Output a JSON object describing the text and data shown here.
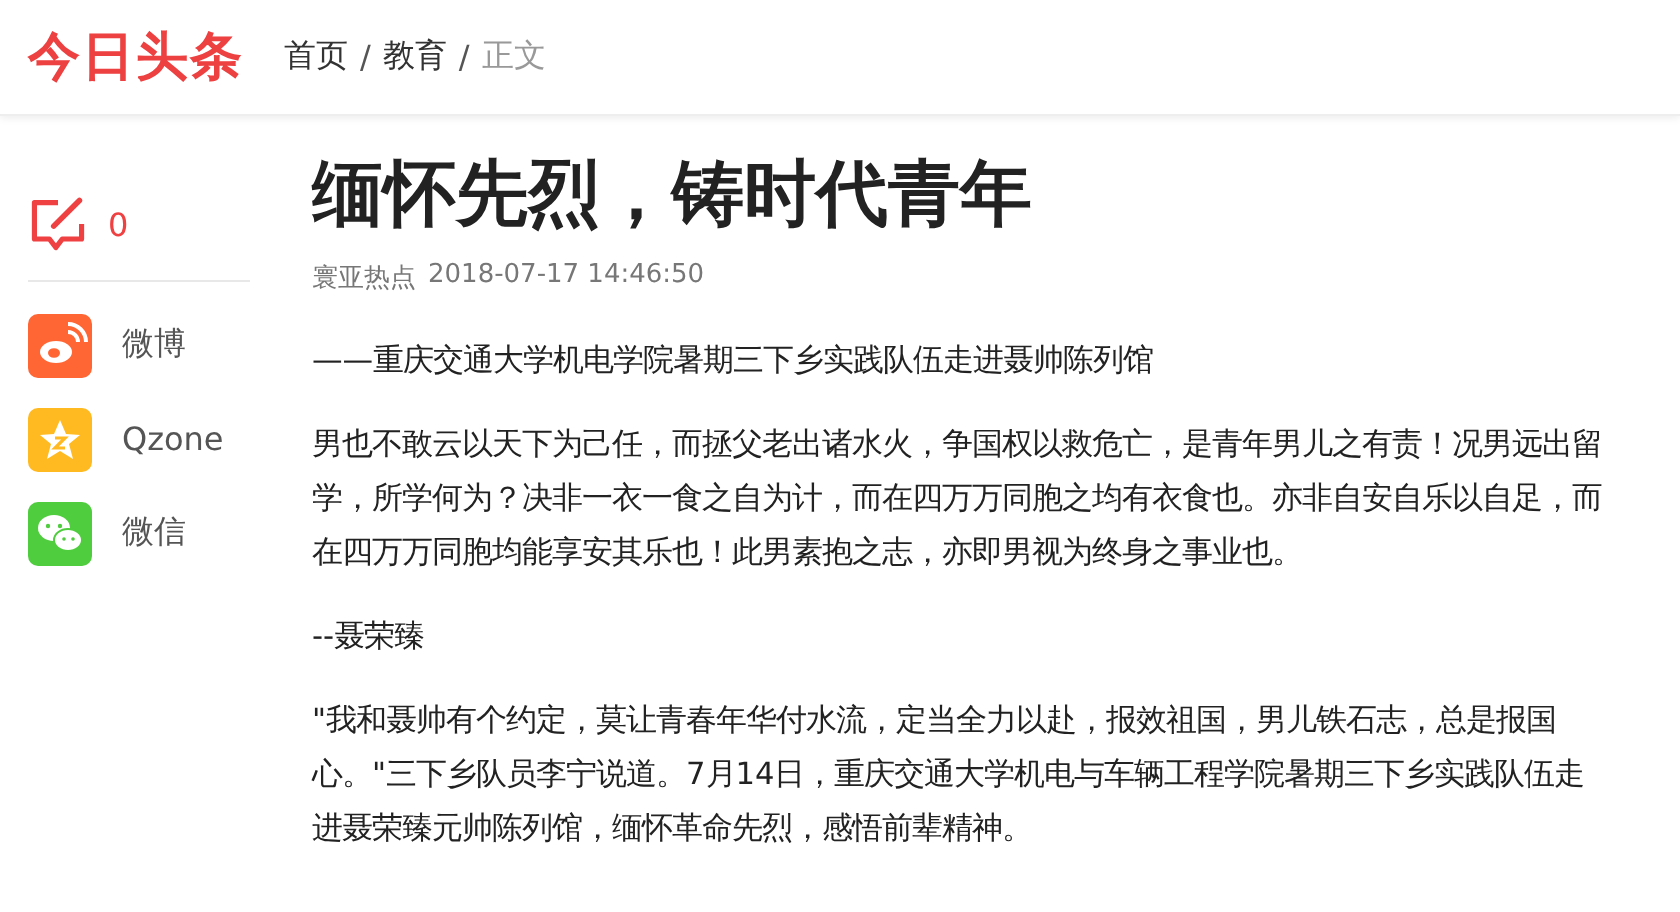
{
  "header": {
    "logo": "今日头条",
    "separator": "/",
    "breadcrumb": [
      {
        "label": "首页",
        "current": false
      },
      {
        "label": "教育",
        "current": false
      },
      {
        "label": "正文",
        "current": true
      }
    ]
  },
  "sidebar": {
    "comment_count": "0",
    "share": [
      {
        "kind": "weibo",
        "label": "微博",
        "color": "#ff6633"
      },
      {
        "kind": "qzone",
        "label": "Qzone",
        "color": "#ffba22"
      },
      {
        "kind": "wechat",
        "label": "微信",
        "color": "#4fcd3e"
      }
    ]
  },
  "article": {
    "title": "缅怀先烈，铸时代青年",
    "source": "寰亚热点",
    "time": "2018-07-17 14:46:50",
    "paragraphs": [
      "——重庆交通大学机电学院暑期三下乡实践队伍走进聂帅陈列馆",
      "男也不敢云以天下为己任，而拯父老出诸水火，争国权以救危亡，是青年男儿之有责！况男远出留学，所学何为？决非一衣一食之自为计，而在四万万同胞之均有衣食也。亦非自安自乐以自足，而在四万万同胞均能享安其乐也！此男素抱之志，亦即男视为终身之事业也。",
      "--聂荣臻",
      "\"我和聂帅有个约定，莫让青春年华付水流，定当全力以赴，报效祖国，男儿铁石志，总是报国心。\"三下乡队员李宁说道。7月14日，重庆交通大学机电与车辆工程学院暑期三下乡实践队伍走进聂荣臻元帅陈列馆，缅怀革命先烈，感悟前辈精神。"
    ]
  }
}
